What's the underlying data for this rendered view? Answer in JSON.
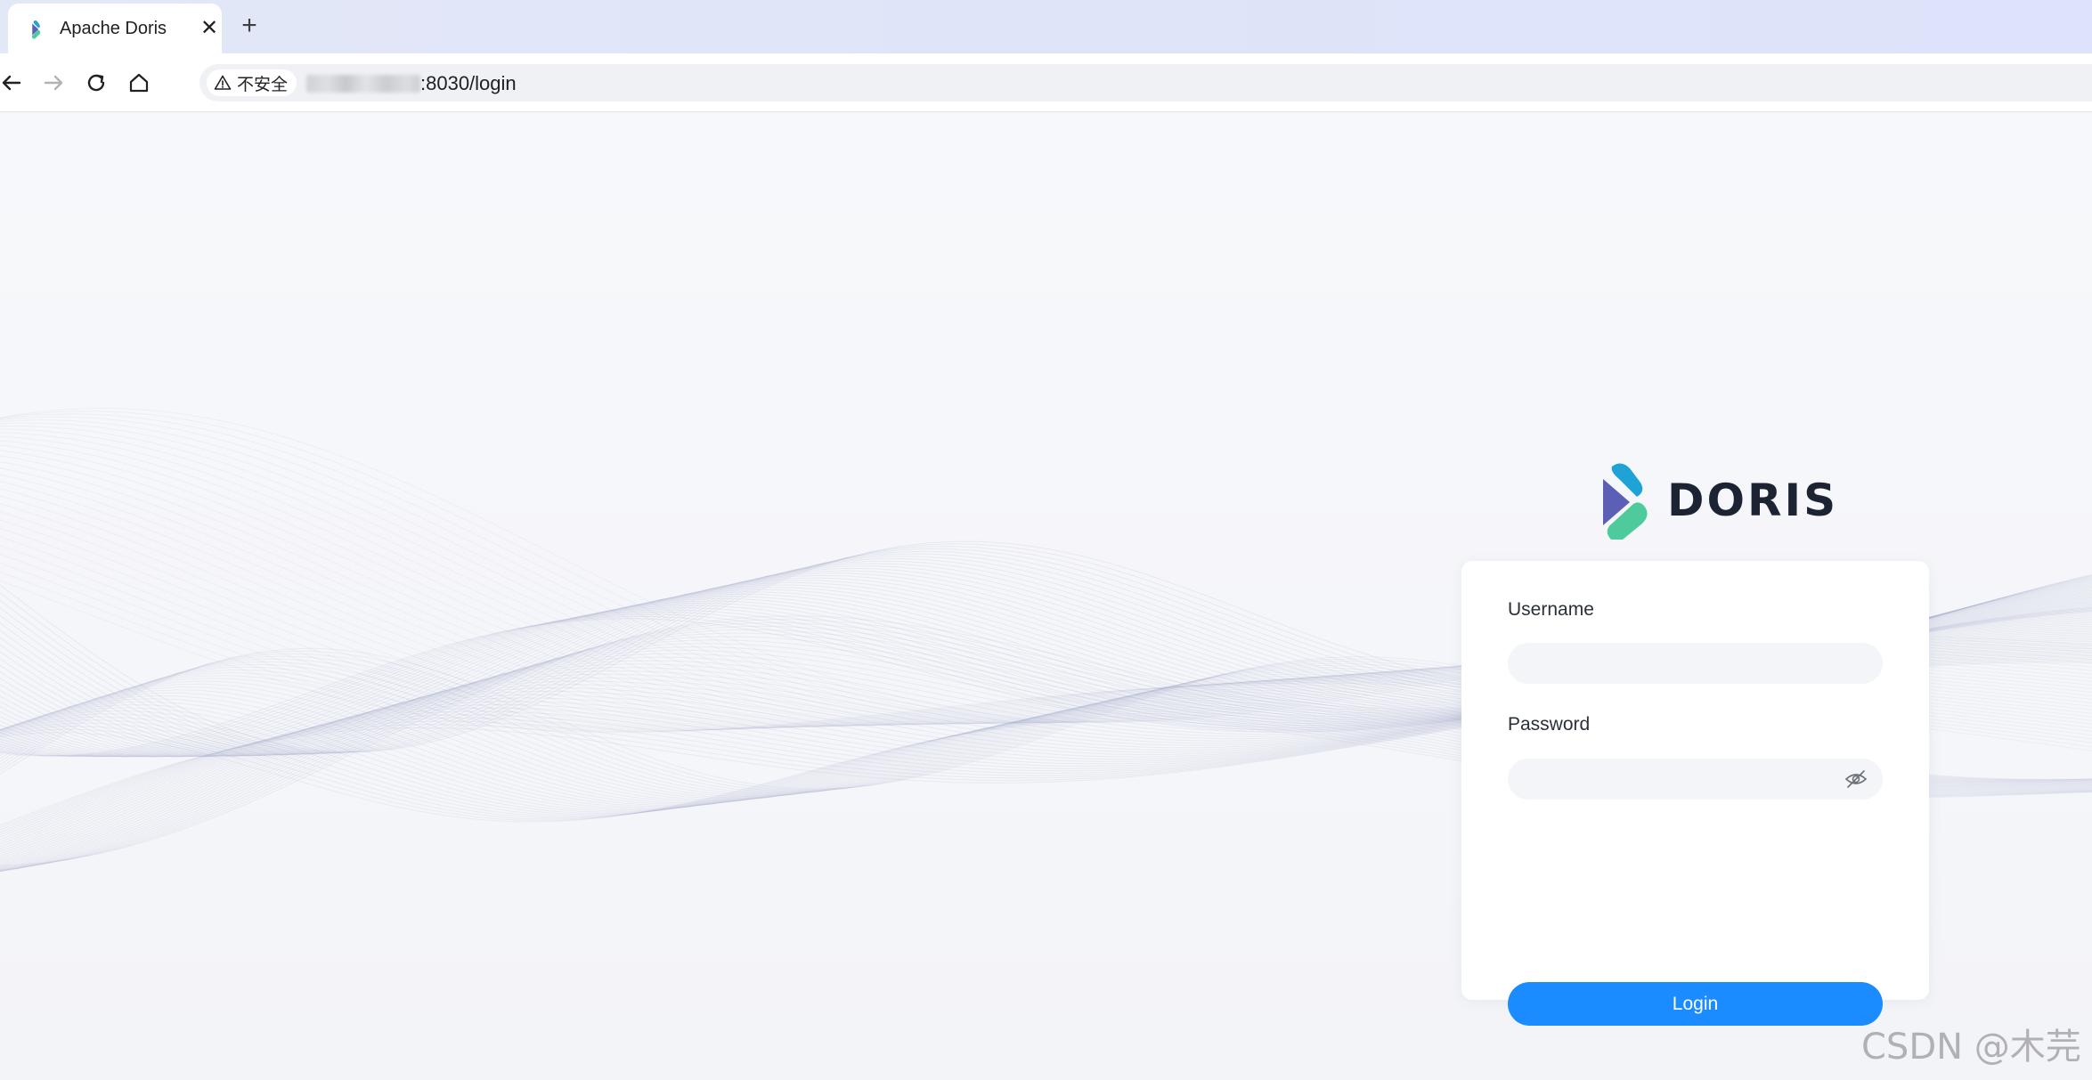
{
  "browser": {
    "tab": {
      "title": "Apache Doris",
      "favicon": "doris-logo-icon",
      "close_icon": "close-icon"
    },
    "new_tab_icon": "plus-icon",
    "nav": {
      "back_icon": "arrow-left-icon",
      "forward_icon": "arrow-right-icon",
      "reload_icon": "reload-icon",
      "home_icon": "home-icon"
    },
    "address_bar": {
      "security_icon": "warning-triangle-icon",
      "security_label": "不安全",
      "url_visible": ":8030/login",
      "host_obscured": true
    }
  },
  "page": {
    "logo": {
      "mark": "doris-logo-mark",
      "wordmark": "DORIS"
    },
    "login_form": {
      "username_label": "Username",
      "username_value": "",
      "password_label": "Password",
      "password_value": "",
      "password_toggle_icon": "eye-off-icon",
      "submit_label": "Login"
    },
    "watermark": "CSDN @木芫"
  },
  "colors": {
    "accent": "#1a8cff",
    "page_background": "#f6f7fa",
    "wave_tint": "#9ea3c7",
    "logo_blue": "#1fa3d6",
    "logo_purple": "#5b5fb5",
    "logo_green": "#4ecb9c",
    "wordmark": "#1c2434"
  }
}
